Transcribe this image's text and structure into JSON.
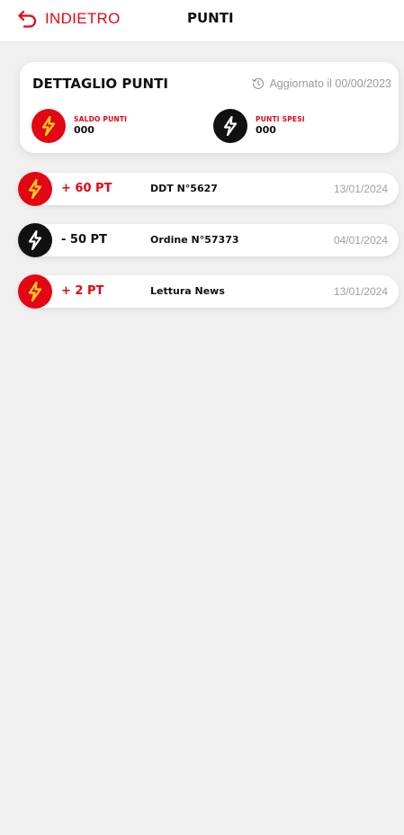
{
  "header": {
    "back_label": "INDIETRO",
    "title": "PUNTI"
  },
  "summary": {
    "title": "DETTAGLIO PUNTI",
    "updated_text": "Aggiornato il 00/00/2023",
    "saldo": {
      "label": "SALDO PUNTI",
      "value": "000"
    },
    "spesi": {
      "label": "PUNTI SPESI",
      "value": "000"
    }
  },
  "transactions": [
    {
      "points": "+ 60 PT",
      "description": "DDT N°5627",
      "date": "13/01/2024",
      "kind": "gain"
    },
    {
      "points": "- 50 PT",
      "description": "Ordine N°57373",
      "date": "04/01/2024",
      "kind": "spend"
    },
    {
      "points": "+ 2 PT",
      "description": "Lettura News",
      "date": "13/01/2024",
      "kind": "gain"
    }
  ],
  "colors": {
    "accent": "#e30613",
    "dark": "#111111",
    "bolt_on_red": "#ffd21f",
    "bolt_on_black": "#ffffff",
    "background": "#f0f0f0"
  },
  "icons": {
    "back": "back-arrow-icon",
    "updated": "history-clock-icon",
    "bolt": "lightning-bolt-icon"
  }
}
